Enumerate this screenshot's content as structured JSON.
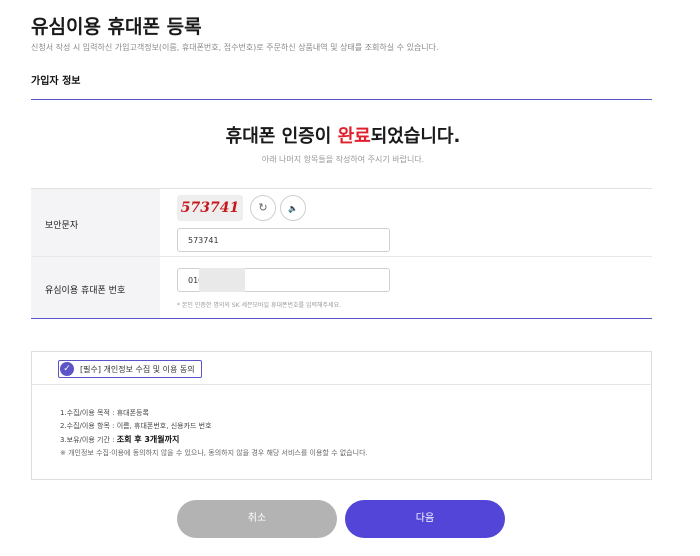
{
  "header": {
    "title": "유심이용 휴대폰 등록",
    "subtitle": "신청서 작성 시 입력하신 가입고객정보(이름, 휴대폰번호, 접수번호)로 주문하신 상품내역 및 상태를 조회하실 수 있습니다."
  },
  "section": {
    "label": "가입자 정보"
  },
  "auth": {
    "heading_before": "휴대폰 인증이 ",
    "heading_accent": "완료",
    "heading_after": "되었습니다.",
    "subtext": "아래 나머지 항목들을 작성하여 주시기 바랍니다."
  },
  "form": {
    "security_label": "보안문자",
    "captcha_text": "573741",
    "refresh_icon": "↻",
    "audio_icon": "🔈",
    "captcha_input_value": "573741",
    "phone_label": "유심이용 휴대폰 번호",
    "phone_input_value": "010",
    "phone_hint": "* 본인 인증한 명의의 SK 세븐모바일 휴대폰번호를 입력해주세요."
  },
  "agreement": {
    "checkbox_label": "[필수] 개인정보 수집 및 이용 동의",
    "checked": true,
    "check_glyph": "✓",
    "line1": "1.수집/이용 목적 : 휴대폰등록",
    "line2": "2.수집/이용 항목 : 이름, 휴대폰번호, 신용카드 번호",
    "line3_prefix": "3.보유/이용 기간 : ",
    "line3_bold": "조회 후 3개월까지",
    "note": "※ 개인정보 수집·이용에 동의하지 않을 수 있으나, 동의하지 않을 경우 해당 서비스를 이용할 수 없습니다."
  },
  "buttons": {
    "cancel": "취소",
    "next": "다음"
  },
  "colors": {
    "accent_purple": "#5245d8",
    "accent_red": "#e0212b",
    "cancel_gray": "#b3b3b3"
  }
}
